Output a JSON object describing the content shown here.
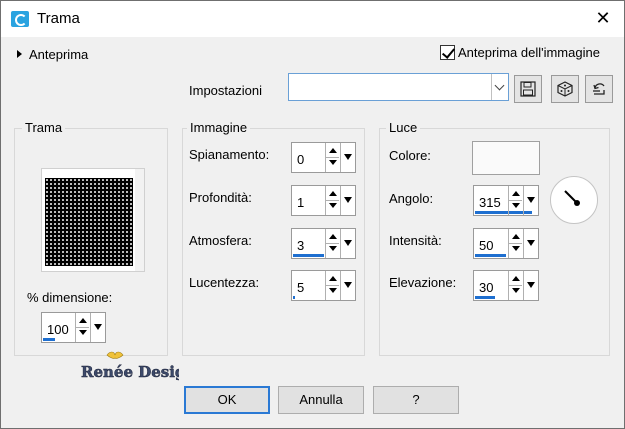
{
  "window": {
    "title": "Trama",
    "close_glyph": "✕"
  },
  "preview": {
    "toggle_label": "Anteprima",
    "image_preview_label": "Anteprima dell'immagine",
    "image_preview_checked": true
  },
  "settings": {
    "label": "Impostazioni",
    "value": "",
    "buttons": [
      "save-icon",
      "random-dice-icon",
      "reset-icon"
    ]
  },
  "trama": {
    "group_label": "Trama",
    "size_label": "% dimensione:",
    "size_value": "100"
  },
  "immagine": {
    "group_label": "Immagine",
    "fields": [
      {
        "label": "Spianamento:",
        "value": "0"
      },
      {
        "label": "Profondità:",
        "value": "1"
      },
      {
        "label": "Atmosfera:",
        "value": "3"
      },
      {
        "label": "Lucentezza:",
        "value": "5"
      }
    ]
  },
  "luce": {
    "group_label": "Luce",
    "color_label": "Colore:",
    "color_value": "#fafafa",
    "fields": [
      {
        "label": "Angolo:",
        "value": "315"
      },
      {
        "label": "Intensità:",
        "value": "50"
      },
      {
        "label": "Elevazione:",
        "value": "30"
      }
    ]
  },
  "watermark": {
    "text": "Renée Design"
  },
  "buttons": {
    "ok": "OK",
    "cancel": "Annulla",
    "help": "?"
  },
  "colors": {
    "accent": "#1e6fd0",
    "dialog_bg": "#f0f0f0",
    "app_icon": "#2aa3e0"
  }
}
